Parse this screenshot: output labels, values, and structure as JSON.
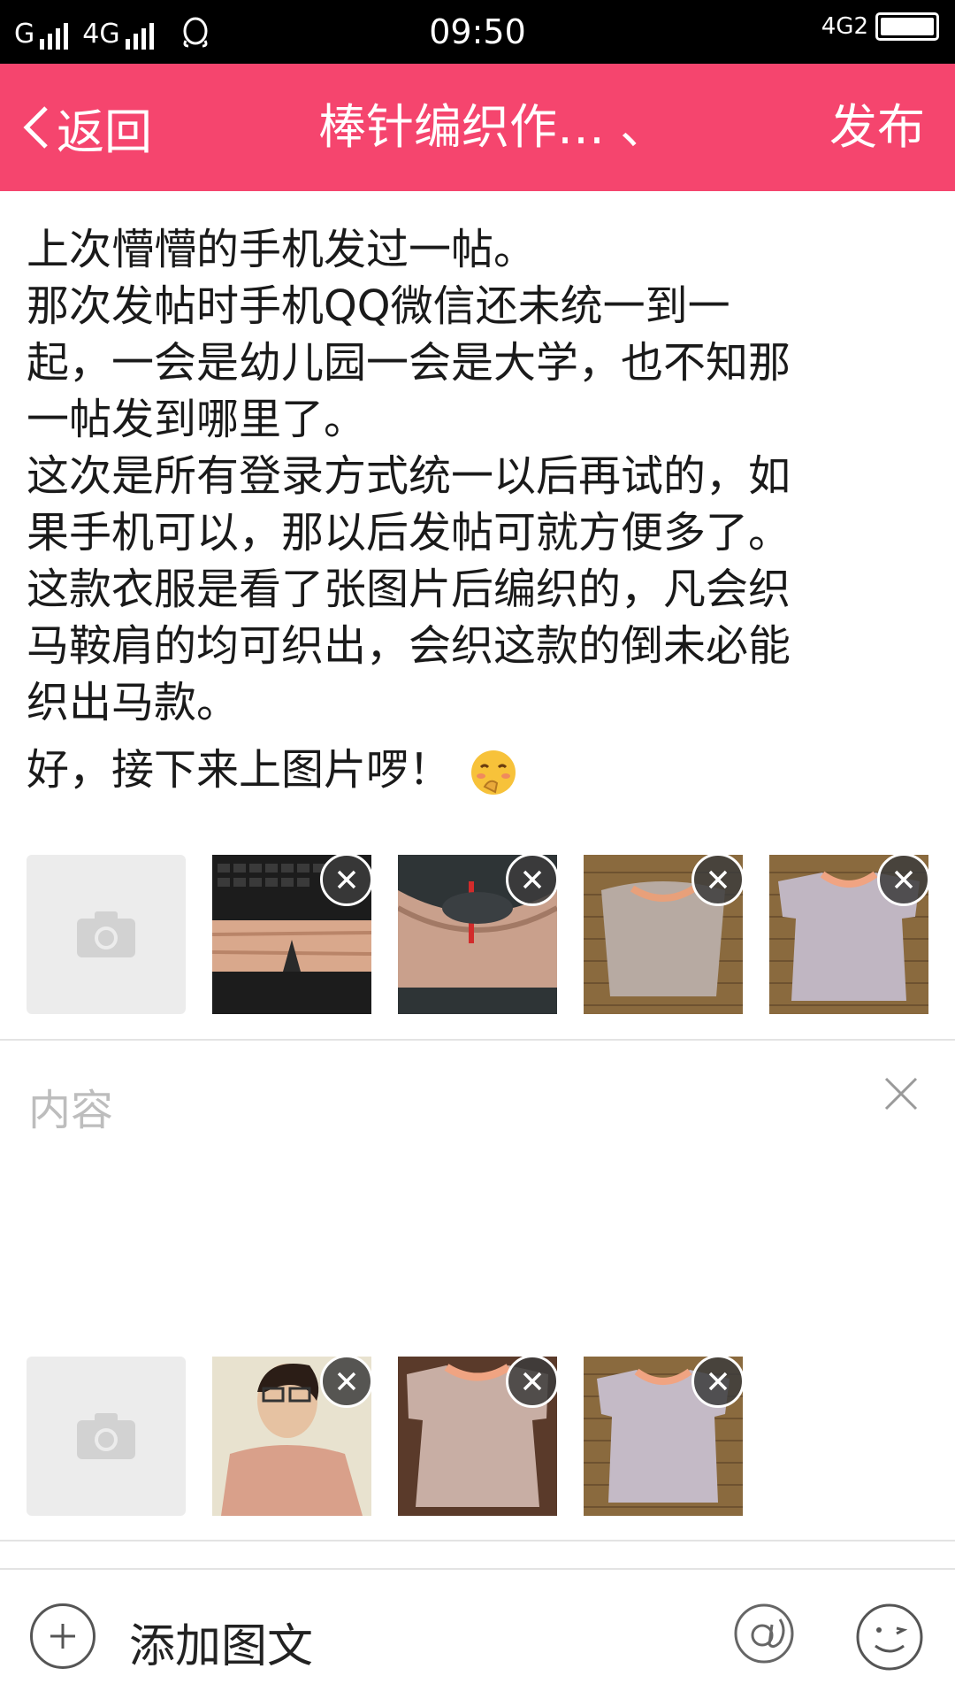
{
  "status": {
    "carrier1": "G",
    "carrier2": "4G",
    "time": "09:50",
    "network_right": "4G2"
  },
  "header": {
    "back_label": "返回",
    "title": "棒针编织作…  、",
    "publish_label": "发布",
    "color": "#f5456e"
  },
  "post": {
    "lines": [
      "上次懵懵的手机发过一帖。",
      "那次发帖时手机QQ微信还未统一到一",
      "起，一会是幼儿园一会是大学，也不知那",
      "一帖发到哪里了。",
      "这次是所有登录方式统一以后再试的，如",
      "果手机可以，那以后发帖可就方便多了。",
      "这款衣服是看了张图片后编织的，凡会织",
      "马鞍肩的均可织出，会织这款的倒未必能",
      "织出马款。",
      "好，接下来上图片啰！"
    ],
    "emoji": "blushing-face-icon"
  },
  "image_rows": [
    {
      "add_icon": "camera-icon",
      "thumbs": [
        {
          "icon": "knitting-on-keyboard-photo",
          "remove_icon": "close-icon"
        },
        {
          "icon": "knitting-with-needle-photo",
          "remove_icon": "close-icon"
        },
        {
          "icon": "sweater-on-mat-photo",
          "remove_icon": "close-icon"
        },
        {
          "icon": "finished-sweater-photo",
          "remove_icon": "close-icon"
        }
      ]
    },
    {
      "add_icon": "camera-icon",
      "thumbs": [
        {
          "icon": "woman-wearing-sweater-photo",
          "remove_icon": "close-icon"
        },
        {
          "icon": "sweater-back-photo",
          "remove_icon": "close-icon"
        },
        {
          "icon": "sweater-flat-photo",
          "remove_icon": "close-icon"
        }
      ]
    }
  ],
  "content_section": {
    "placeholder": "内容",
    "clear_icon": "close-icon"
  },
  "bottom_bar": {
    "add_label": "添加图文",
    "add_icon": "plus-circle-icon",
    "mention_icon": "at-icon",
    "emoji_icon": "smiley-icon"
  }
}
